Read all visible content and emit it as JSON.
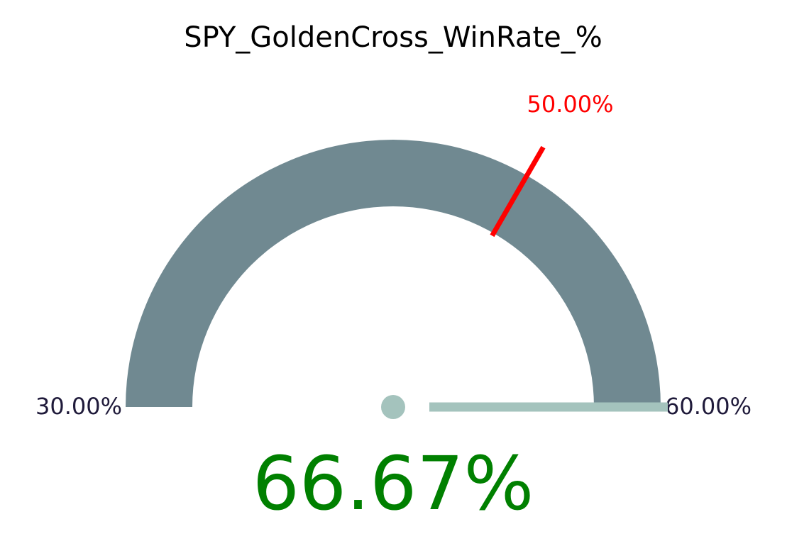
{
  "chart_data": {
    "type": "gauge",
    "title": "SPY_GoldenCross_WinRate_%",
    "min": 30.0,
    "max": 60.0,
    "min_label": "30.00%",
    "max_label": "60.00%",
    "threshold": 50.0,
    "threshold_label": "50.00%",
    "value": 66.67,
    "value_label": "66.67%",
    "colors": {
      "arc": "#708991",
      "threshold": "#ff0000",
      "threshold_text": "#ff0000",
      "needle": "#a4c3bd",
      "value_text": "#008000",
      "range_text": "#1f1a3a",
      "title_text": "#000000"
    }
  }
}
